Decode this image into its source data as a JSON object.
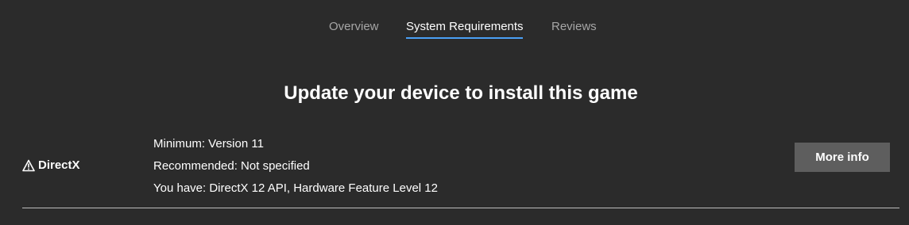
{
  "tabs": [
    {
      "label": "Overview",
      "active": false
    },
    {
      "label": "System Requirements",
      "active": true
    },
    {
      "label": "Reviews",
      "active": false
    }
  ],
  "heading": "Update your device to install this game",
  "requirement": {
    "icon": "warning-icon",
    "name": "DirectX",
    "minimum": "Minimum: Version 11",
    "recommended": "Recommended: Not specified",
    "you_have": "You have: DirectX 12 API, Hardware Feature Level 12",
    "button_label": "More info"
  },
  "colors": {
    "background": "#2b2b2b",
    "accent": "#4aa0f5",
    "button": "#5e5e5e"
  }
}
